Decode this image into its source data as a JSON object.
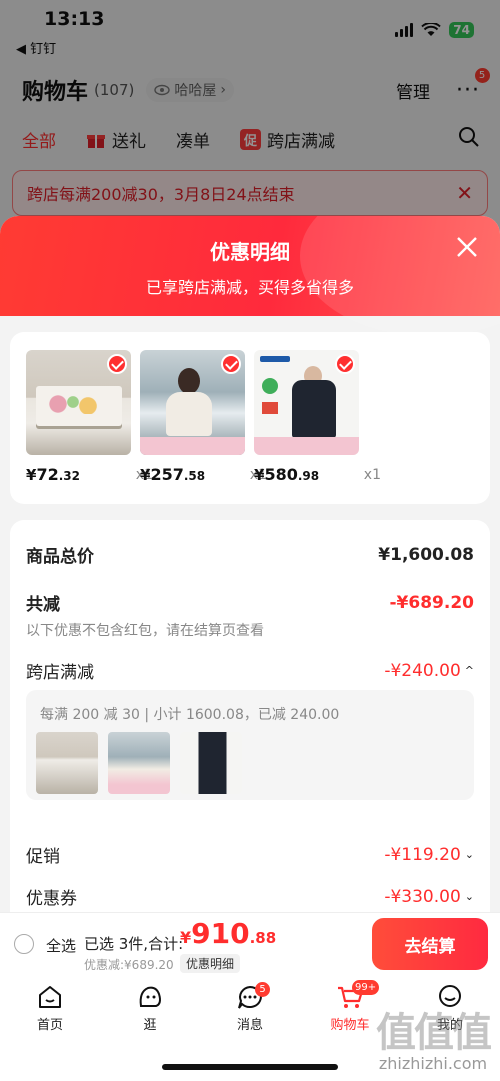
{
  "status_bar": {
    "time": "13:13",
    "back_app": "◀ 钉钉",
    "battery": "74"
  },
  "header": {
    "title": "购物车",
    "count": "(107)",
    "viewer": "哈哈屋",
    "manage": "管理",
    "more_badge": "5"
  },
  "tabs": [
    {
      "label": "全部",
      "active": true
    },
    {
      "label": "送礼",
      "icon": "gift-icon"
    },
    {
      "label": "凑单"
    },
    {
      "label": "跨店满减",
      "chip": "促"
    }
  ],
  "banner": {
    "text": "跨店每满200减30，3月8日24点结束"
  },
  "sheet": {
    "title": "优惠明细",
    "subtitle": "已享跨店满减，买得多省得多",
    "products": [
      {
        "currency": "¥",
        "price_int": "72",
        "price_dec": ".32",
        "qty": "x1"
      },
      {
        "currency": "¥",
        "price_int": "257",
        "price_dec": ".58",
        "qty": "x1"
      },
      {
        "currency": "¥",
        "price_int": "580",
        "price_dec": ".98",
        "qty": "x1"
      }
    ],
    "summary": {
      "total_label": "商品总价",
      "total_value": "¥1,600.08",
      "reduce_label": "共减",
      "reduce_value": "-¥689.20",
      "note": "以下优惠不包含红包，请在结算页查看",
      "cross_store_label": "跨店满减",
      "cross_store_value": "-¥240.00",
      "rule_text": "每满 200 减 30 | 小计 1600.08，已减 240.00",
      "promo_label": "促销",
      "promo_value": "-¥119.20",
      "coupon_label": "优惠券",
      "coupon_value": "-¥330.00"
    }
  },
  "checkout": {
    "select_all": "全选",
    "selected": "已选 3件,合计:",
    "currency": "¥",
    "total_int": "910",
    "total_dec": ".88",
    "discount": "优惠减:¥689.20",
    "detail_button": "优惠明细",
    "pay_button": "去结算"
  },
  "tabbar": [
    {
      "label": "首页",
      "icon": "home-icon"
    },
    {
      "label": "逛",
      "icon": "explore-icon"
    },
    {
      "label": "消息",
      "icon": "message-icon",
      "badge": "5"
    },
    {
      "label": "购物车",
      "icon": "cart-icon",
      "badge": "99+",
      "active": true
    },
    {
      "label": "我的",
      "icon": "profile-icon"
    }
  ],
  "watermark": {
    "logo": "值值值",
    "text": "zhizhizhi.com"
  },
  "colors": {
    "accent": "#ff2d2d",
    "header_gradient_start": "#ff3b33",
    "header_gradient_end": "#ff5a55"
  }
}
